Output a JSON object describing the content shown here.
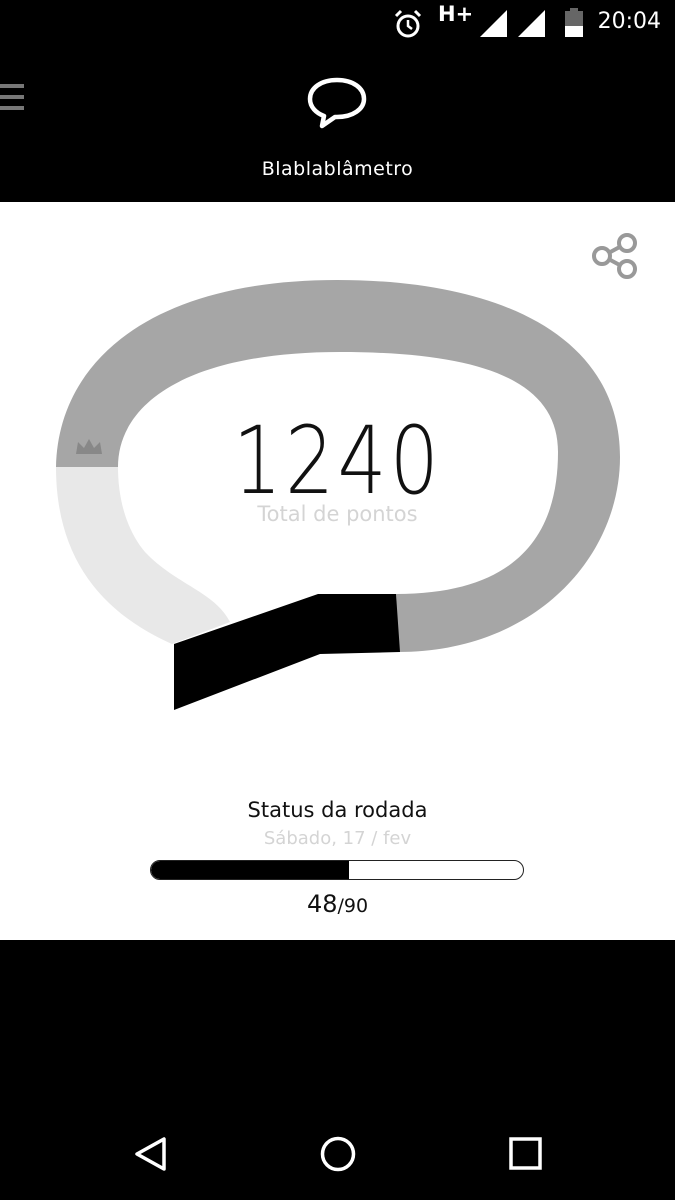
{
  "status_bar": {
    "network": "H+",
    "time": "20:04",
    "icons": [
      "alarm-icon",
      "signal-icon",
      "signal-icon",
      "battery-icon"
    ]
  },
  "header": {
    "title": "Blablablâmetro",
    "menu_icon": "hamburger-menu-icon",
    "logo_icon": "speech-bubble-icon"
  },
  "main": {
    "share_icon": "share-icon",
    "rank_icon": "crown-icon",
    "total_points": "1240",
    "total_label": "Total de pontos",
    "gauge_colors": {
      "filled": "#a6a6a6",
      "unfilled": "#e8e8e8",
      "current": "#000000"
    }
  },
  "round_status": {
    "title": "Status da rodada",
    "date": "Sábado, 17 / fev",
    "current": "48",
    "max": "/90",
    "progress_fraction": 0.533
  },
  "nav": {
    "back_icon": "back-triangle-icon",
    "home_icon": "home-circle-icon",
    "recents_icon": "recents-square-icon"
  }
}
